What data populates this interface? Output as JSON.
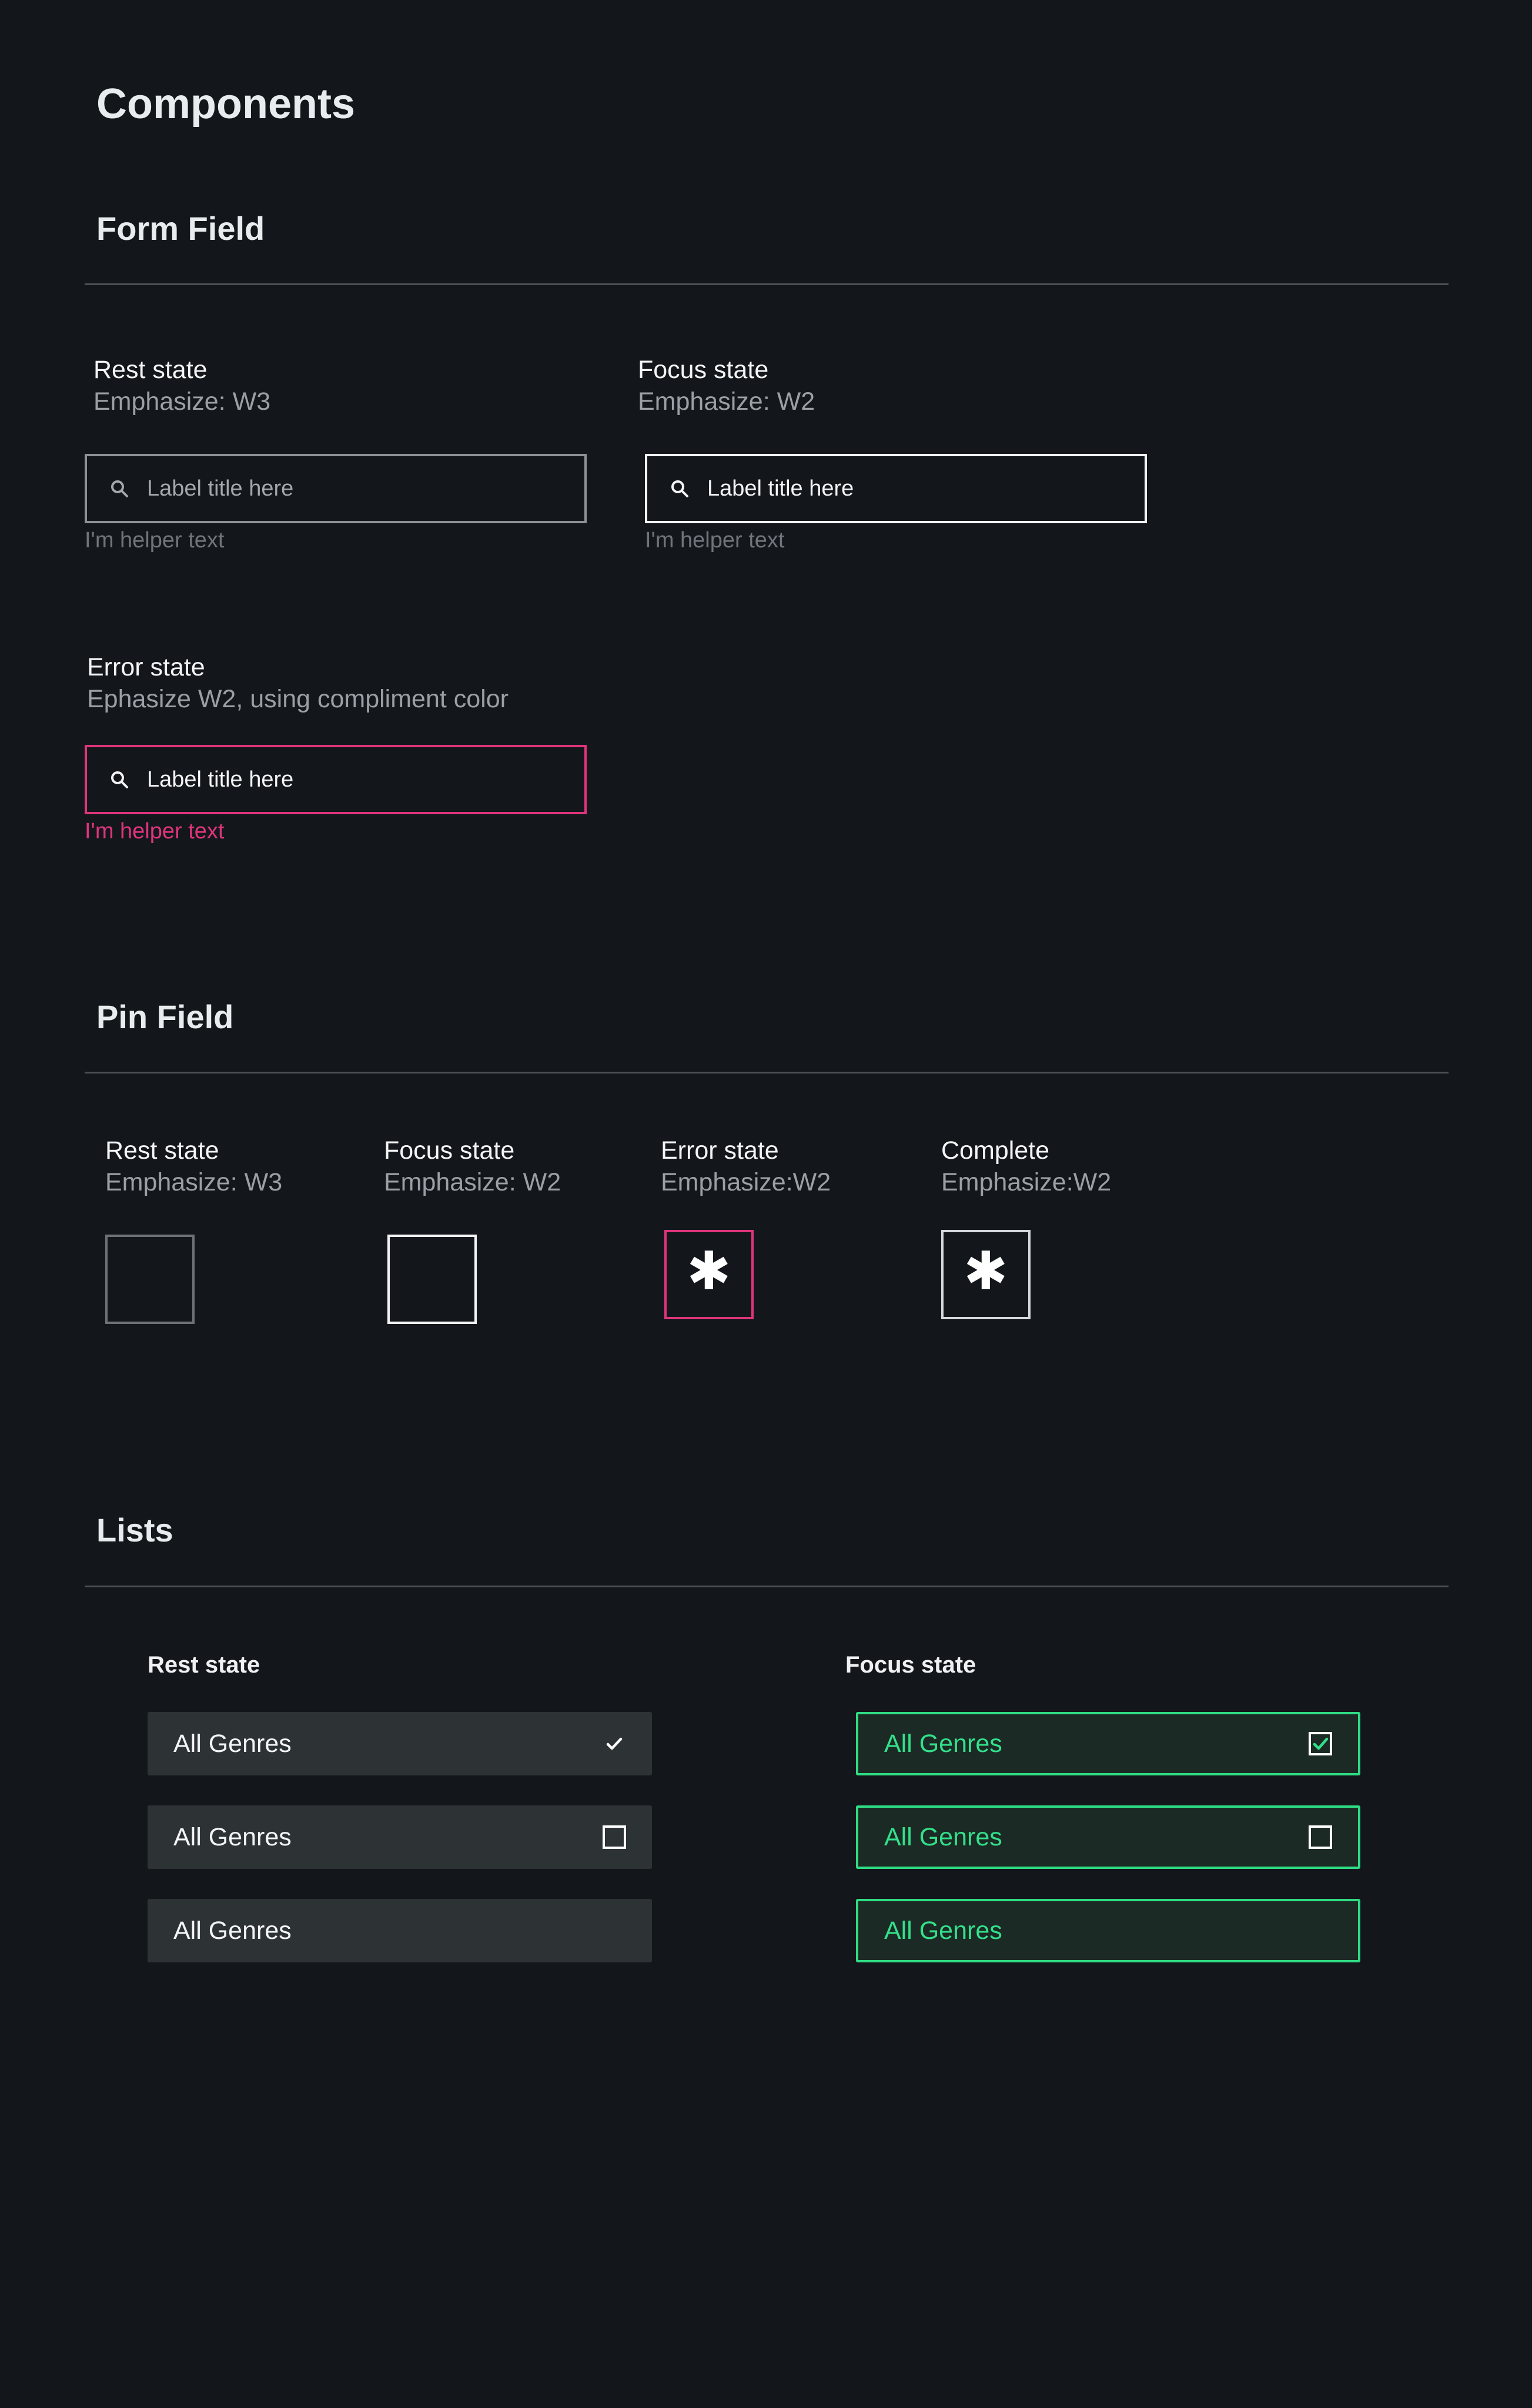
{
  "page": {
    "title": "Components"
  },
  "colors": {
    "background": "#13171b",
    "error": "#e0347c",
    "focus_green": "#2fdc84",
    "list_rest_bg": "#2d3235",
    "list_focus_bg": "#1c2a25"
  },
  "form_field": {
    "title": "Form Field",
    "rest": {
      "title": "Rest state",
      "subtitle": "Emphasize: W3",
      "label": "Label title here",
      "helper": "I'm helper text",
      "icon": "search-icon"
    },
    "focus": {
      "title": "Focus state",
      "subtitle": "Emphasize: W2",
      "label": "Label title here",
      "helper": "I'm helper text",
      "icon": "search-icon"
    },
    "error": {
      "title": "Error state",
      "subtitle": "Ephasize W2, using compliment color",
      "label": "Label title here",
      "helper": "I'm helper text",
      "icon": "search-icon"
    }
  },
  "pin_field": {
    "title": "Pin Field",
    "rest": {
      "title": "Rest state",
      "subtitle": "Emphasize: W3",
      "value": ""
    },
    "focus": {
      "title": "Focus state",
      "subtitle": "Emphasize: W2",
      "value": ""
    },
    "error": {
      "title": "Error state",
      "subtitle": "Emphasize:W2",
      "value": "✱"
    },
    "complete": {
      "title": "Complete",
      "subtitle": "Emphasize:W2",
      "value": "✱"
    }
  },
  "lists": {
    "title": "Lists",
    "rest": {
      "title": "Rest state",
      "items": [
        {
          "label": "All Genres",
          "indicator": "check-icon"
        },
        {
          "label": "All Genres",
          "indicator": "checkbox-empty-icon"
        },
        {
          "label": "All Genres",
          "indicator": "none"
        }
      ]
    },
    "focus": {
      "title": "Focus state",
      "items": [
        {
          "label": "All Genres",
          "indicator": "checkbox-checked-icon"
        },
        {
          "label": "All Genres",
          "indicator": "checkbox-empty-icon"
        },
        {
          "label": "All Genres",
          "indicator": "none"
        }
      ]
    }
  }
}
